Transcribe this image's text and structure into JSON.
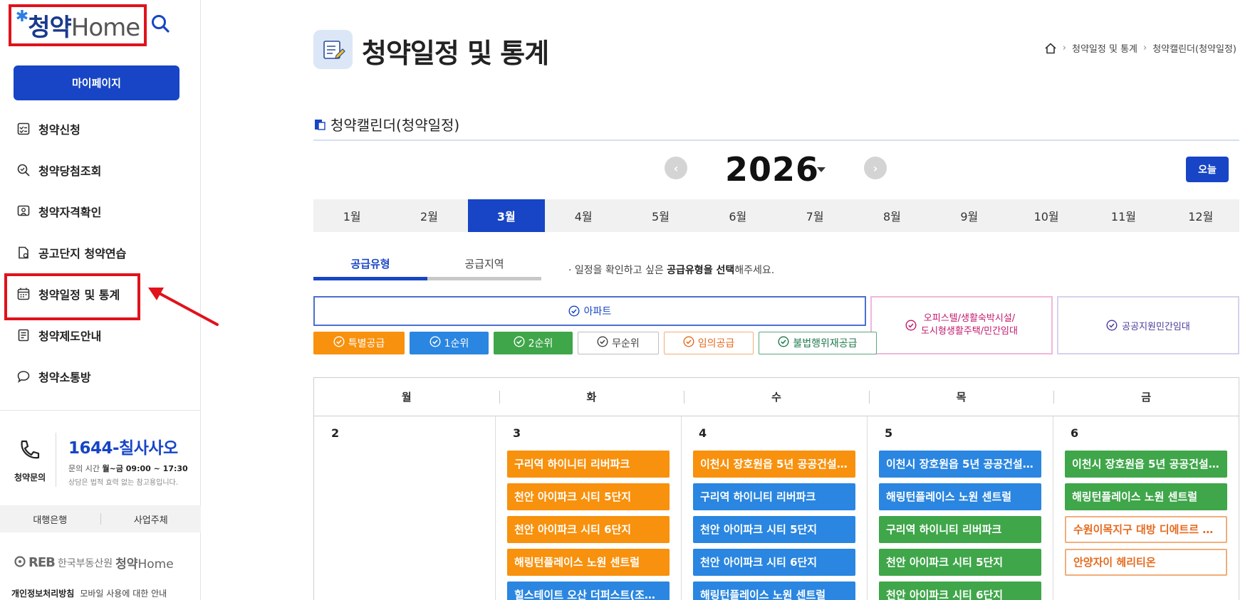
{
  "sidebar": {
    "logo_ko": "청약",
    "logo_en": "Home",
    "mypage_label": "마이페이지",
    "nav": [
      {
        "label": "청약신청"
      },
      {
        "label": "청약당첨조회"
      },
      {
        "label": "청약자격확인"
      },
      {
        "label": "공고단지 청약연습"
      },
      {
        "label": "청약일정 및 통계"
      },
      {
        "label": "청약제도안내"
      },
      {
        "label": "청약소통방"
      }
    ],
    "contact": {
      "label": "청약문의",
      "number": "1644-칠사사오",
      "hours_prefix": "문의 시간",
      "hours": "월~금 09:00 ~ 17:30",
      "note": "상담은 법적 효력 없는 참고용입니다."
    },
    "bottom_tabs": [
      "대행은행",
      "사업주체"
    ],
    "footer_logo": {
      "reb": "REB",
      "org": "한국부동산원",
      "brand_ko": "청약",
      "brand_en": "Home"
    },
    "footer_links": [
      "개인정보처리방침",
      "모바일 사용에 대한 안내"
    ]
  },
  "header": {
    "title": "청약일정 및 통계",
    "breadcrumb": [
      "청약일정 및 통계",
      "청약캘린더(청약일정)"
    ]
  },
  "section_title": "청약캘린더(청약일정)",
  "calendar": {
    "year": "2026",
    "today_label": "오늘",
    "months": [
      "1월",
      "2월",
      "3월",
      "4월",
      "5월",
      "6월",
      "7월",
      "8월",
      "9월",
      "10월",
      "11월",
      "12월"
    ],
    "active_month": "3월",
    "type_tabs": [
      "공급유형",
      "공급지역"
    ],
    "hint_prefix": "· 일정을 확인하고 싶은 ",
    "hint_bold": "공급유형을 선택",
    "hint_suffix": "해주세요.",
    "filters": {
      "apt": "아파트",
      "officetel_line1": "오피스텔/생활숙박시설/",
      "officetel_line2": "도시형생활주택/민간임대",
      "public": "공공지원민간임대"
    },
    "chips": [
      {
        "label": "특별공급",
        "bg": "#f8910d",
        "fg": "#ffffff",
        "border": "#f8910d"
      },
      {
        "label": "1순위",
        "bg": "#2a86e0",
        "fg": "#ffffff",
        "border": "#2a86e0"
      },
      {
        "label": "2순위",
        "bg": "#3fa64a",
        "fg": "#ffffff",
        "border": "#3fa64a"
      },
      {
        "label": "무순위",
        "bg": "#ffffff",
        "fg": "#444444",
        "border": "#bdbdbd"
      },
      {
        "label": "임의공급",
        "bg": "#ffffff",
        "fg": "#e66a1d",
        "border": "#f1ae7b"
      },
      {
        "label": "불법행위재공급",
        "bg": "#ffffff",
        "fg": "#1f7a4d",
        "border": "#5aa77e"
      }
    ],
    "weekdays": [
      "월",
      "화",
      "수",
      "목",
      "금"
    ],
    "days": [
      {
        "num": "2",
        "events": []
      },
      {
        "num": "3",
        "events": [
          {
            "text": "구리역 하이니티 리버파크",
            "style": "orange"
          },
          {
            "text": "천안 아이파크 시티 5단지",
            "style": "orange"
          },
          {
            "text": "천안 아이파크 시티 6단지",
            "style": "orange"
          },
          {
            "text": "해링턴플레이스 노원 센트럴",
            "style": "orange"
          },
          {
            "text": "힐스테이트 오산 더퍼스트(조합...",
            "style": "blue"
          }
        ]
      },
      {
        "num": "4",
        "events": [
          {
            "text": "이천시 장호원읍 5년 공공건설...",
            "style": "orange"
          },
          {
            "text": "구리역 하이니티 리버파크",
            "style": "blue"
          },
          {
            "text": "천안 아이파크 시티 5단지",
            "style": "blue"
          },
          {
            "text": "천안 아이파크 시티 6단지",
            "style": "blue"
          },
          {
            "text": "해링턴플레이스 노원 센트럴",
            "style": "blue"
          }
        ]
      },
      {
        "num": "5",
        "events": [
          {
            "text": "이천시 장호원읍 5년 공공건설...",
            "style": "blue"
          },
          {
            "text": "해링턴플레이스 노원 센트럴",
            "style": "blue"
          },
          {
            "text": "구리역 하이니티 리버파크",
            "style": "green"
          },
          {
            "text": "천안 아이파크 시티 5단지",
            "style": "green"
          },
          {
            "text": "천안 아이파크 시티 6단지",
            "style": "green"
          }
        ]
      },
      {
        "num": "6",
        "events": [
          {
            "text": "이천시 장호원읍 5년 공공건설...",
            "style": "green"
          },
          {
            "text": "해링턴플레이스 노원 센트럴",
            "style": "green"
          },
          {
            "text": "수원이목지구 대방 디에트르 더...",
            "style": "outline-orange"
          },
          {
            "text": "안양자이 헤리티온",
            "style": "outline-orange"
          }
        ]
      }
    ]
  },
  "colors": {
    "primary": "#1745c5",
    "highlight": "#e0121b"
  }
}
